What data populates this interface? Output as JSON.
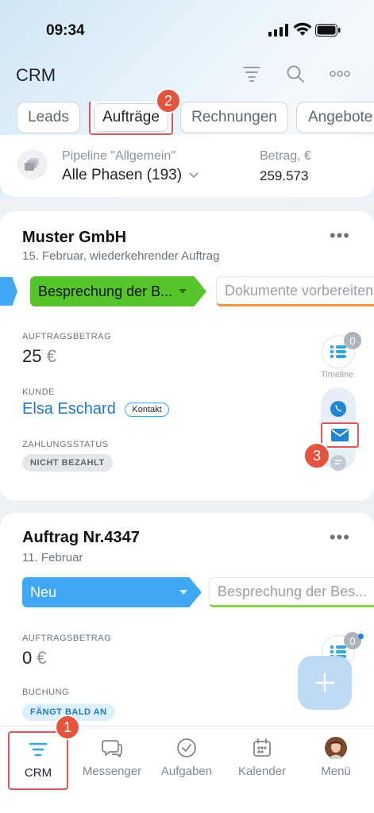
{
  "status": {
    "time": "09:34"
  },
  "header": {
    "title": "CRM"
  },
  "tabs": [
    {
      "label": "Leads"
    },
    {
      "label": "Aufträge"
    },
    {
      "label": "Rechnungen"
    },
    {
      "label": "Angebote"
    }
  ],
  "badges": {
    "one": "1",
    "two": "2",
    "three": "3"
  },
  "pipeline": {
    "label": "Pipeline \"Allgemein\"",
    "value": "Alle Phasen (193)",
    "amount_label": "Betrag, €",
    "amount_value": "259.573"
  },
  "deals": [
    {
      "title": "Muster GmbH",
      "subtitle": "15. Februar, wiederkehrender Auftrag",
      "stage_current": "Besprechung der B...",
      "stage_next": "Dokumente vorbereiten",
      "amount_label": "AUFTRAGSBETRAG",
      "amount_value": "25",
      "currency": "€",
      "client_label": "KUNDE",
      "client_name": "Elsa Eschard",
      "client_tag": "Kontakt",
      "payment_label": "ZAHLUNGSSTATUS",
      "payment_status": "NICHT BEZAHLT",
      "timeline_label": "Timeline",
      "timeline_count": "0"
    },
    {
      "title": "Auftrag Nr.4347",
      "subtitle": "11. Februar",
      "stage_current": "Neu",
      "stage_next": "Besprechung der Bes...",
      "amount_label": "AUFTRAGSBETRAG",
      "amount_value": "0",
      "currency": "€",
      "booking_label": "BUCHUNG",
      "booking_status": "FÄNGT BALD AN",
      "timeline_count": "0"
    }
  ],
  "tabbar": [
    {
      "label": "CRM"
    },
    {
      "label": "Messenger"
    },
    {
      "label": "Aufgaben"
    },
    {
      "label": "Kalender"
    },
    {
      "label": "Menü"
    }
  ],
  "colors": {
    "accent": "#2fa6e6",
    "stage_green": "#55c52a",
    "stage_blue": "#3fa9f5",
    "highlight": "#dd5a5a",
    "badge": "#e5533d",
    "stage_next_underline_1": "#f0963a",
    "stage_next_underline_2": "#8ad14a"
  }
}
